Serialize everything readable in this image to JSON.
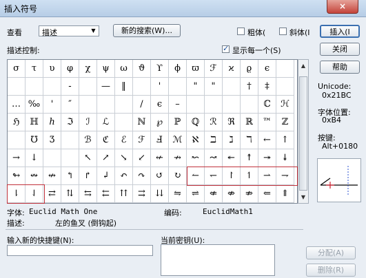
{
  "window": {
    "title": "插入符号",
    "close_label": "×"
  },
  "toolbar": {
    "view_label": "查看",
    "view_value": "描述",
    "new_search_label": "新的搜索(W)...",
    "bold_label": "粗体(",
    "italic_label": "斜体(I",
    "insert_label": "插入(I"
  },
  "description_control": {
    "label": "描述控制:",
    "show_one_label": "显示每一个(S)",
    "show_one_checked": true
  },
  "side_buttons": {
    "close": "关闭",
    "help": "帮助"
  },
  "info_panel": {
    "unicode_label": "Unicode:",
    "unicode_value": "0x21BC",
    "position_label": "字体位置:",
    "position_value": "0xB4",
    "key_label": "按键:",
    "key_value": "Alt+0180"
  },
  "symbols": [
    [
      "σ",
      "τ",
      "υ",
      "φ",
      "χ",
      "ψ",
      "ω",
      "ϑ",
      "ϒ",
      "ϕ",
      "ϖ",
      "ℱ",
      "ϰ",
      "ϱ",
      "ϵ",
      "",
      ""
    ],
    [
      "",
      "",
      "",
      "-",
      "",
      "—",
      "‖",
      "",
      "'",
      "",
      "\"",
      "\"",
      "",
      "†",
      "‡",
      "",
      ""
    ],
    [
      "…",
      "‰",
      "'",
      "″",
      "",
      "",
      "",
      "/",
      "ϵ",
      "–",
      "",
      "",
      "",
      "",
      "ℂ",
      "ℋ",
      ""
    ],
    [
      "ℌ",
      "ℍ",
      "ℎ",
      "ℑ",
      "ℐ",
      "ℒ",
      "",
      "ℕ",
      "℘",
      "ℙ",
      "ℚ",
      "ℛ",
      "ℜ",
      "ℝ",
      "™",
      "ℤ",
      ""
    ],
    [
      "",
      "℧",
      "Ʒ",
      "",
      "ℬ",
      "ℭ",
      "ℰ",
      "ℱ",
      "Ⅎ",
      "ℳ",
      "ℵ",
      "ℶ",
      "ℷ",
      "ℸ",
      "←",
      "↑",
      ""
    ],
    [
      "→",
      "↓",
      "",
      "",
      "↖",
      "↗",
      "↘",
      "↙",
      "↚",
      "↛",
      "↜",
      "↝",
      "↞",
      "↟",
      "↠",
      "↡",
      ""
    ],
    [
      "↬",
      "↭",
      "↮",
      "↰",
      "↱",
      "↲",
      "↶",
      "↷",
      "↺",
      "↻",
      "↼",
      "↽",
      "↾",
      "↿",
      "⇀",
      "⇁",
      ""
    ],
    [
      "⇂",
      "⇃",
      "⇄",
      "⇅",
      "⇆",
      "⇇",
      "⇈",
      "⇉",
      "⇊",
      "⇋",
      "⇌",
      "⇍",
      "⇎",
      "⇏",
      "⇐",
      "⇑",
      ""
    ]
  ],
  "font_info": {
    "font_label": "字体:",
    "font_value": "Euclid Math One",
    "code_label": "编码:",
    "code_value": "EuclidMath1"
  },
  "description_info": {
    "label": "描述:",
    "value": "左的鱼叉 (倒钩起)"
  },
  "shortcut": {
    "new_key_label": "输入新的快捷键(N):",
    "current_key_label": "当前密钥(U):",
    "assign_label": "分配(A)",
    "delete_label": "删除(R)"
  }
}
